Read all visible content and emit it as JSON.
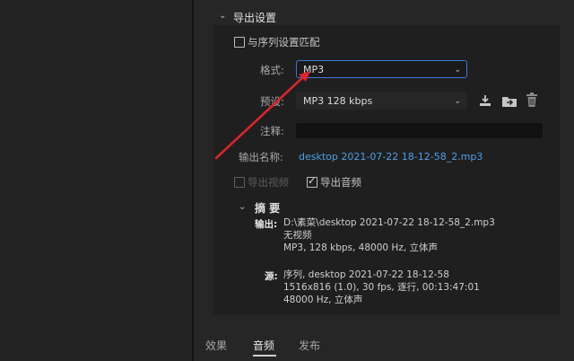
{
  "export_settings": {
    "section_title": "导出设置",
    "match_sequence_label": "与序列设置匹配",
    "format": {
      "label": "格式:",
      "value": "MP3"
    },
    "preset": {
      "label": "预设:",
      "value": "MP3 128 kbps"
    },
    "comments": {
      "label": "注释:",
      "value": ""
    },
    "output_name": {
      "label": "输出名称:",
      "value": "desktop 2021-07-22 18-12-58_2.mp3"
    },
    "export_video_label": "导出视频",
    "export_audio_label": "导出音频",
    "summary": {
      "title": "摘 要",
      "output_label": "输出:",
      "output_lines": [
        "D:\\素菜\\desktop 2021-07-22 18-12-58_2.mp3",
        "无视频",
        "MP3, 128 kbps, 48000 Hz, 立体声"
      ],
      "source_label": "源:",
      "source_lines": [
        "序列, desktop 2021-07-22 18-12-58",
        "1516x816 (1.0), 30 fps, 逐行, 00:13:47:01",
        "48000 Hz, 立体声"
      ]
    }
  },
  "tabs": [
    {
      "label": "效果",
      "active": false
    },
    {
      "label": "音频",
      "active": true
    },
    {
      "label": "发布",
      "active": false
    }
  ],
  "colors": {
    "accent_border": "#3a78d8",
    "link": "#4f9fe8",
    "arrow": "#d9252b"
  },
  "icons": [
    "chevron-down-icon",
    "save-preset-icon",
    "import-preset-icon",
    "delete-preset-icon",
    "dropdown-caret-icon"
  ]
}
